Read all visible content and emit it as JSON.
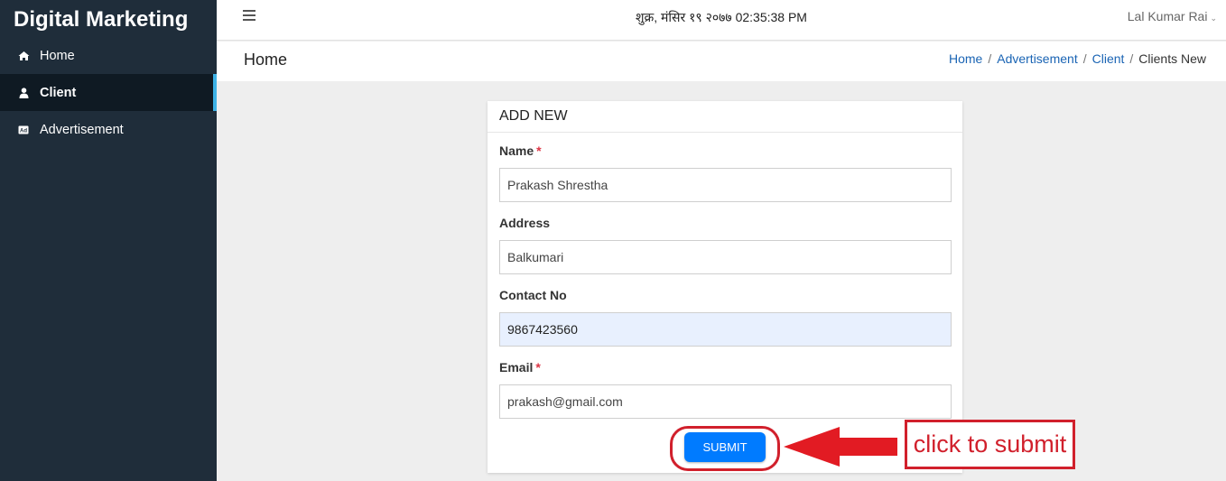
{
  "sidebar": {
    "brand": "Digital Marketing",
    "items": [
      {
        "label": "Home",
        "icon": "home-icon"
      },
      {
        "label": "Client",
        "icon": "user-icon"
      },
      {
        "label": "Advertisement",
        "icon": "ad-icon"
      }
    ]
  },
  "topbar": {
    "datetime": "शुक्र, मंसिर १९ २०७७ 02:35:38 PM",
    "user": "Lal Kumar Rai"
  },
  "page": {
    "title": "Home",
    "breadcrumb": [
      "Home",
      "Advertisement",
      "Client",
      "Clients New"
    ]
  },
  "form": {
    "title": "ADD NEW",
    "name_label": "Name",
    "name_value": "Prakash Shrestha",
    "address_label": "Address",
    "address_value": "Balkumari",
    "contact_label": "Contact No",
    "contact_value": "9867423560",
    "email_label": "Email",
    "email_value": "prakash@gmail.com",
    "required_mark": "*",
    "submit_label": "SUBMIT"
  },
  "annotation": {
    "text": "click to submit",
    "color": "#d1202c"
  },
  "colors": {
    "sidebar_bg": "#1f2d3a",
    "active_accent": "#3eb2e6",
    "primary": "#007bff",
    "link": "#1a64b4"
  }
}
